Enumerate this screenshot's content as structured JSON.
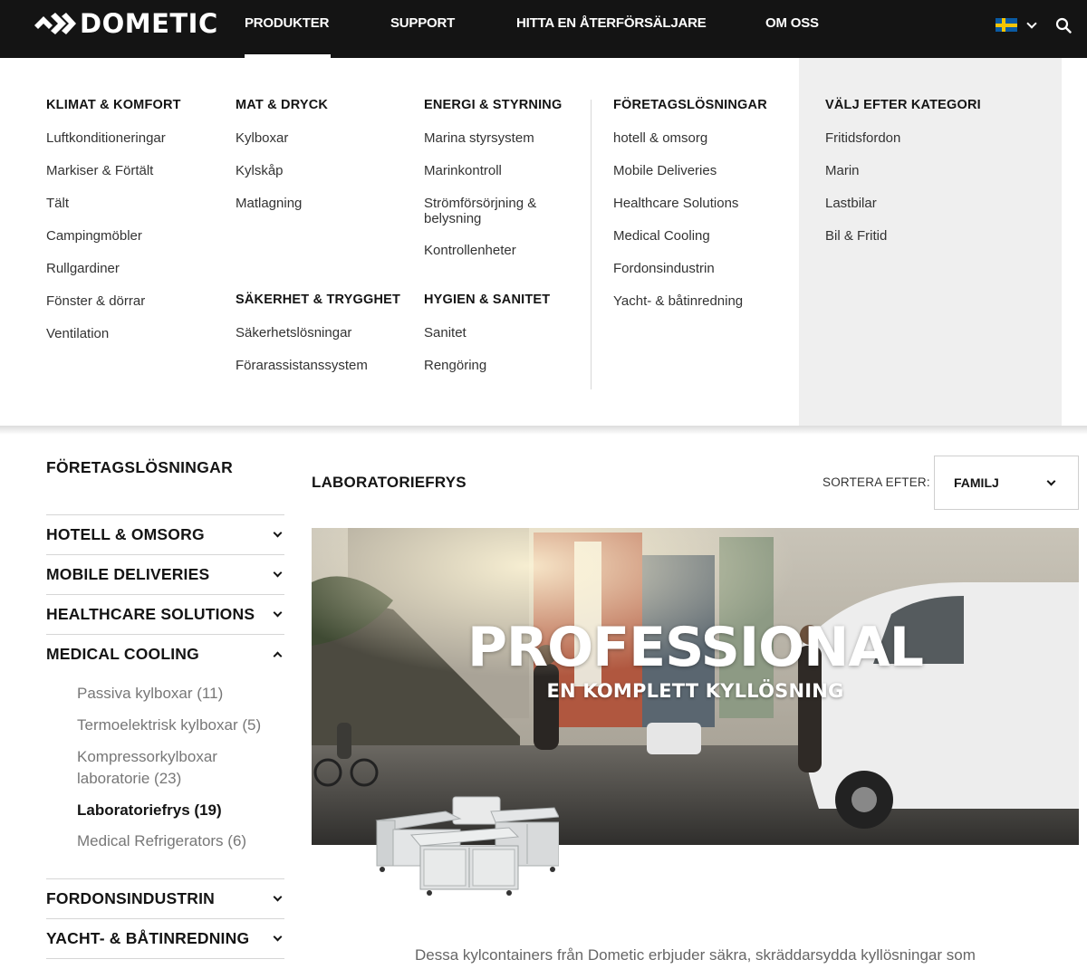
{
  "brand": {
    "name": "DOMETIC"
  },
  "nav": {
    "items": [
      "PRODUKTER",
      "SUPPORT",
      "HITTA EN ÅTERFÖRSÄLJARE",
      "OM OSS"
    ],
    "active": "PRODUKTER",
    "language_icon": "swedish-flag-icon",
    "search_icon": "search-icon"
  },
  "mega_menu": {
    "klimat": {
      "heading": "KLIMAT & KOMFORT",
      "links": [
        "Luftkonditioneringar",
        "Markiser & Förtält",
        "Tält",
        "Campingmöbler",
        "Rullgardiner",
        "Fönster & dörrar",
        "Ventilation"
      ]
    },
    "mat": {
      "heading": "MAT & DRYCK",
      "links": [
        "Kylboxar",
        "Kylskåp",
        "Matlagning"
      ]
    },
    "sakerhet": {
      "heading": "SÄKERHET & TRYGGHET",
      "links": [
        "Säkerhetslösningar",
        "Förarassistanssystem"
      ]
    },
    "energi": {
      "heading": "ENERGI & STYRNING",
      "links": [
        "Marina styrsystem",
        "Marinkontroll",
        "Strömförsörjning & belysning",
        "Kontrollenheter"
      ]
    },
    "hygien": {
      "heading": "HYGIEN & SANITET",
      "links": [
        "Sanitet",
        "Rengöring"
      ]
    },
    "foretag": {
      "heading": "FÖRETAGSLÖSNINGAR",
      "links": [
        "hotell & omsorg",
        "Mobile Deliveries",
        "Healthcare Solutions",
        "Medical Cooling",
        "Fordonsindustrin",
        "Yacht- & båtinredning"
      ]
    },
    "kategori": {
      "heading": "VÄLJ EFTER KATEGORI",
      "links": [
        "Fritidsfordon",
        "Marin",
        "Lastbilar",
        "Bil & Fritid"
      ]
    }
  },
  "sidebar": {
    "title": "FÖRETAGSLÖSNINGAR",
    "sections": [
      "HOTELL & OMSORG",
      "MOBILE DELIVERIES",
      "HEALTHCARE SOLUTIONS",
      "MEDICAL COOLING",
      "FORDONSINDUSTRIN",
      "YACHT- & BÅTINREDNING"
    ],
    "expanded": "MEDICAL COOLING",
    "sub_items": [
      "Passiva kylboxar (11)",
      "Termoelektrisk kylboxar (5)",
      "Kompressorkylboxar laboratorie (23)",
      "Laboratoriefrys (19)",
      "Medical Refrigerators (6)"
    ],
    "active_sub": "Laboratoriefrys (19)"
  },
  "main": {
    "title": "LABORATORIEFRYS",
    "sort_label": "SORTERA EFTER:",
    "sort_value": "FAMILJ",
    "hero_title": "PROFESSIONAL",
    "hero_subtitle": "EN KOMPLETT KYLLÖSNING",
    "description": "Dessa kylcontainers från Dometic erbjuder säkra, skräddarsydda kyllösningar som"
  },
  "colors": {
    "topbar": "#141414",
    "mega_grey": "#efefef",
    "text_dark": "#141414",
    "text_muted": "#777777"
  }
}
